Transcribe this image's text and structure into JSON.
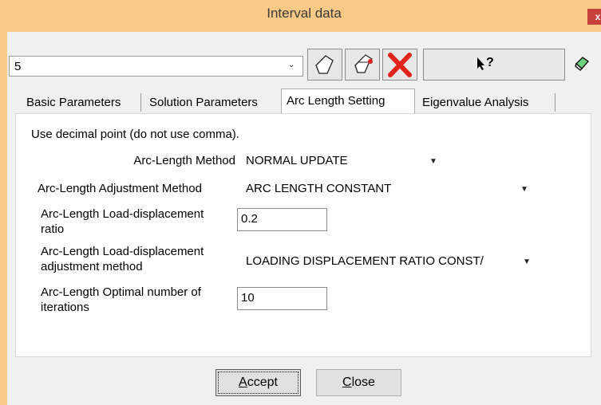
{
  "window": {
    "title": "Interval data",
    "close_glyph": "x"
  },
  "toolbar": {
    "combo_value": "5",
    "buttons": [
      "new-icon",
      "copy-icon",
      "delete-icon"
    ],
    "help_glyph": "?"
  },
  "tabs": [
    {
      "label": "Basic Parameters",
      "active": false
    },
    {
      "label": "Solution Parameters",
      "active": false
    },
    {
      "label": "Arc Length Setting",
      "active": true
    },
    {
      "label": "Eigenvalue Analysis",
      "active": false
    }
  ],
  "form": {
    "hint": "Use decimal point (do not use comma).",
    "method_label": "Arc-Length Method",
    "method_value": "NORMAL UPDATE",
    "adj_method_label": "Arc-Length Adjustment Method",
    "adj_method_value": "ARC LENGTH CONSTANT",
    "ratio_label_1": "Arc-Length Load-displacement",
    "ratio_label_2": "ratio",
    "ratio_value": "0.2",
    "ratio_adj_label_1": "Arc-Length Load-displacement",
    "ratio_adj_label_2": "adjustment method",
    "ratio_adj_value": "LOADING DISPLACEMENT RATIO CONST/",
    "iter_label_1": "Arc-Length Optimal number of",
    "iter_label_2": "iterations",
    "iter_value": "10"
  },
  "buttons": {
    "accept_prefix": "A",
    "accept_rest": "ccept",
    "close_prefix": "C",
    "close_rest": "lose"
  },
  "colors": {
    "title_bg": "#f8c987",
    "close_bg": "#c6413c",
    "delete_red": "#e2231a"
  }
}
